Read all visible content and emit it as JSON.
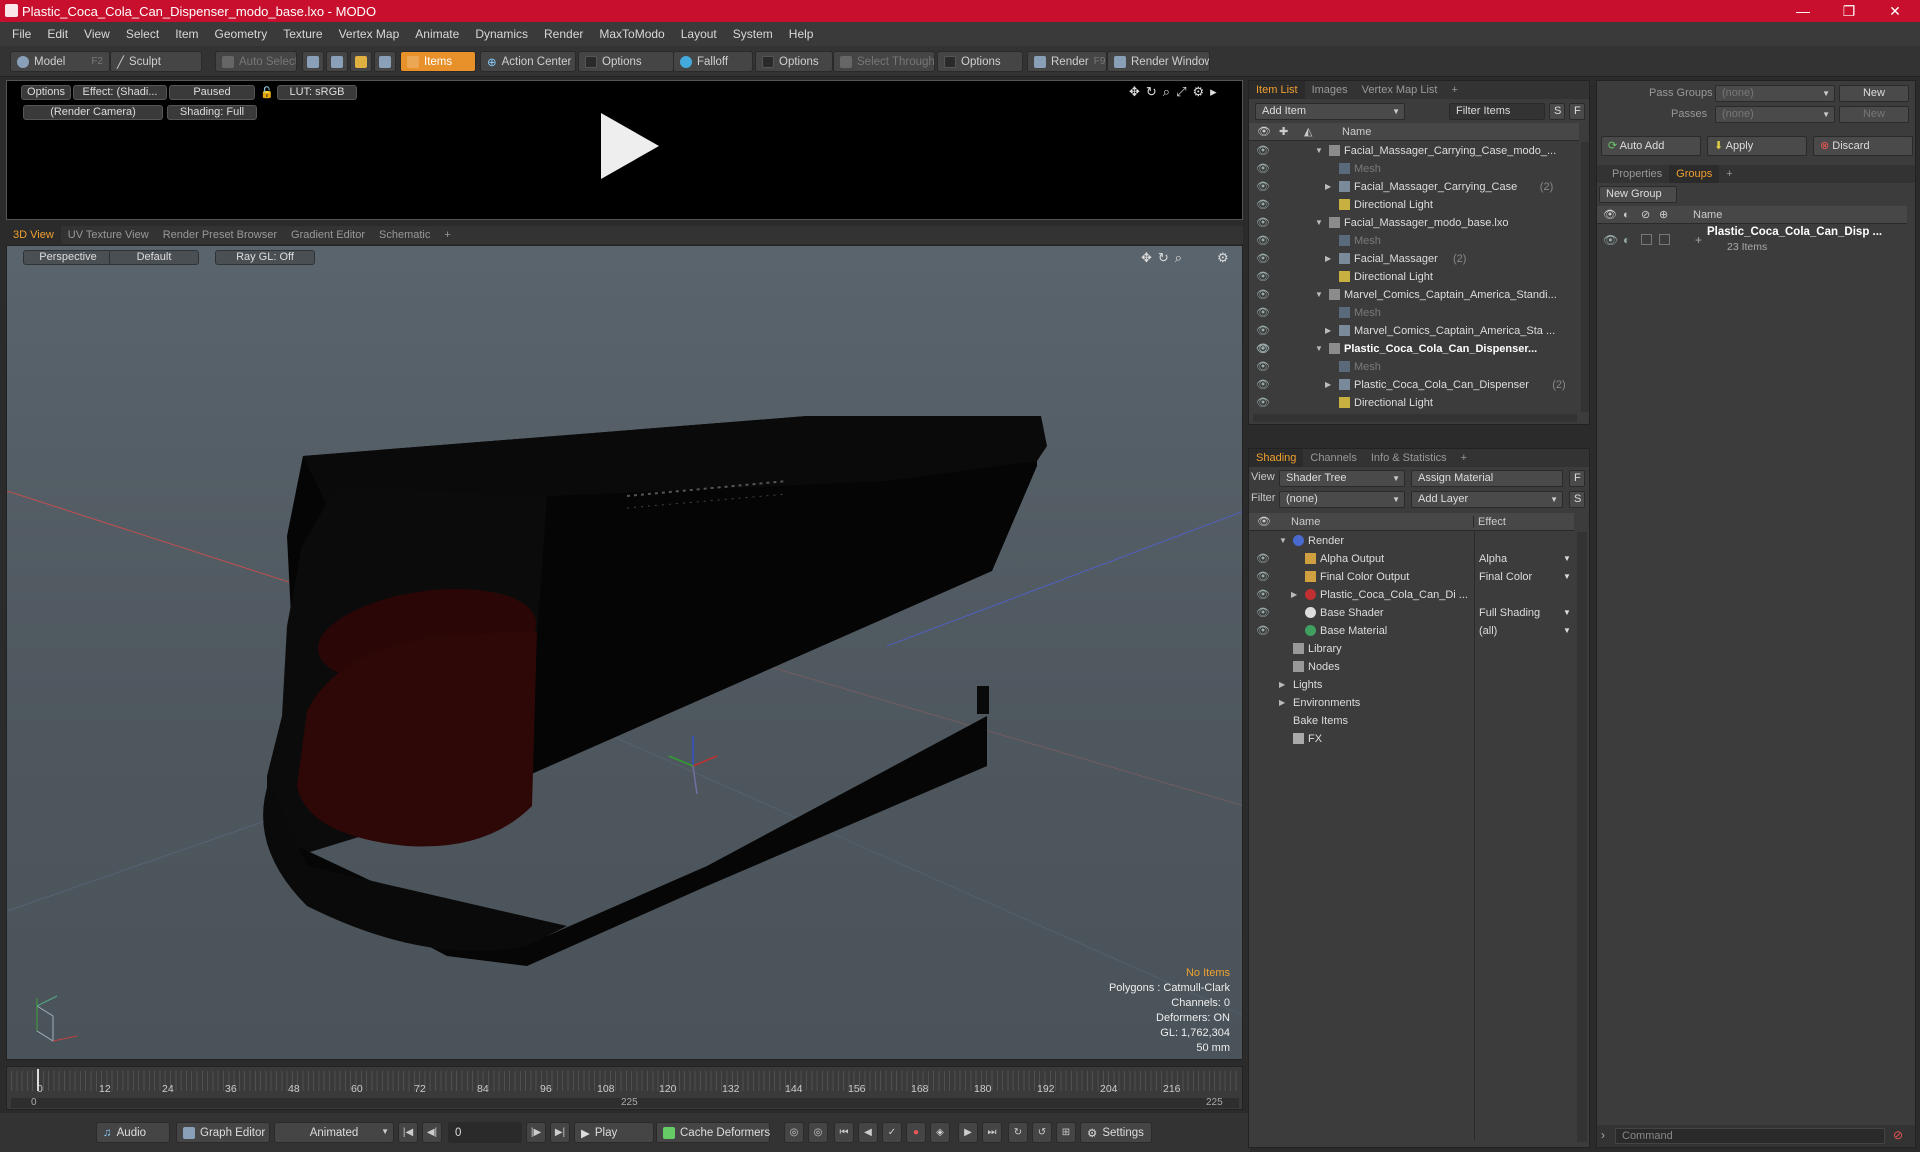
{
  "window": {
    "title": "Plastic_Coca_Cola_Can_Dispenser_modo_base.lxo - MODO",
    "minimize": "—",
    "maximize": "❐",
    "close": "✕"
  },
  "menu": [
    "File",
    "Edit",
    "View",
    "Select",
    "Item",
    "Geometry",
    "Texture",
    "Vertex Map",
    "Animate",
    "Dynamics",
    "Render",
    "MaxToModo",
    "Layout",
    "System",
    "Help"
  ],
  "toolbar": {
    "model": "Model",
    "model_key": "F2",
    "sculpt": "Sculpt",
    "auto_select": "Auto Select",
    "items": "Items",
    "action_center": "Action Center",
    "options1": "Options",
    "falloff": "Falloff",
    "options2": "Options",
    "select_through": "Select Through",
    "options3": "Options",
    "render": "Render",
    "render_key": "F9",
    "render_window": "Render Window"
  },
  "render_view": {
    "options": "Options",
    "effect": "Effect: (Shadi...",
    "paused": "Paused",
    "lut": "LUT: sRGB",
    "camera": "(Render Camera)",
    "shading": "Shading: Full"
  },
  "viewport_tabs": [
    "3D View",
    "UV Texture View",
    "Render Preset Browser",
    "Gradient Editor",
    "Schematic",
    "+"
  ],
  "viewport": {
    "perspective": "Perspective",
    "default": "Default",
    "raygl": "Ray GL: Off",
    "info": {
      "no_items": "No Items",
      "polygons": "Polygons : Catmull-Clark",
      "channels": "Channels: 0",
      "deformers": "Deformers: ON",
      "gl": "GL: 1,762,304",
      "focal": "50 mm"
    }
  },
  "timeline": {
    "ticks": [
      "0",
      "12",
      "24",
      "36",
      "48",
      "60",
      "72",
      "84",
      "96",
      "108",
      "120",
      "132",
      "144",
      "156",
      "168",
      "180",
      "192",
      "204",
      "216"
    ],
    "start": "0",
    "mid": "225",
    "end": "225"
  },
  "bottombar": {
    "audio": "Audio",
    "graph_editor": "Graph Editor",
    "animated": "Animated",
    "frame": "0",
    "play": "Play",
    "cache_deformers": "Cache Deformers",
    "settings": "Settings"
  },
  "itemlist": {
    "tabs": [
      "Item List",
      "Images",
      "Vertex Map List",
      "+"
    ],
    "add_item": "Add Item",
    "filter_items": "Filter Items",
    "s": "S",
    "f": "F",
    "name_header": "Name",
    "rows": [
      {
        "label": "Facial_Massager_Carrying_Case_modo_...",
        "indent": 0,
        "style": "normal",
        "tri": "▼"
      },
      {
        "label": "Mesh",
        "indent": 1,
        "style": "dim",
        "tri": ""
      },
      {
        "label": "Facial_Massager_Carrying_Case",
        "suffix": "(2)",
        "indent": 1,
        "style": "normal",
        "tri": "▶"
      },
      {
        "label": "Directional Light",
        "indent": 1,
        "style": "normal",
        "tri": ""
      },
      {
        "label": "Facial_Massager_modo_base.lxo",
        "indent": 0,
        "style": "normal",
        "tri": "▼"
      },
      {
        "label": "Mesh",
        "indent": 1,
        "style": "dim",
        "tri": ""
      },
      {
        "label": "Facial_Massager",
        "suffix": "(2)",
        "indent": 1,
        "style": "normal",
        "tri": "▶"
      },
      {
        "label": "Directional Light",
        "indent": 1,
        "style": "normal",
        "tri": ""
      },
      {
        "label": "Marvel_Comics_Captain_America_Standi...",
        "indent": 0,
        "style": "normal",
        "tri": "▼"
      },
      {
        "label": "Mesh",
        "indent": 1,
        "style": "dim",
        "tri": ""
      },
      {
        "label": "Marvel_Comics_Captain_America_Sta ...",
        "indent": 1,
        "style": "normal",
        "tri": "▶"
      },
      {
        "label": "Plastic_Coca_Cola_Can_Dispenser...",
        "indent": 0,
        "style": "bold",
        "tri": "▼"
      },
      {
        "label": "Mesh",
        "indent": 1,
        "style": "dim",
        "tri": ""
      },
      {
        "label": "Plastic_Coca_Cola_Can_Dispenser",
        "suffix": "(2)",
        "indent": 1,
        "style": "normal",
        "tri": "▶"
      },
      {
        "label": "Directional Light",
        "indent": 1,
        "style": "normal",
        "tri": ""
      }
    ]
  },
  "shading": {
    "tabs": [
      "Shading",
      "Channels",
      "Info & Statistics",
      "+"
    ],
    "view_label": "View",
    "view_value": "Shader Tree",
    "assign_material": "Assign Material",
    "f": "F",
    "filter_label": "Filter",
    "filter_value": "(none)",
    "add_layer": "Add Layer",
    "s": "S",
    "name_header": "Name",
    "effect_header": "Effect",
    "rows": [
      {
        "label": "Render",
        "effect": "",
        "indent": 0,
        "tri": "▼",
        "icon": "render",
        "eye": false
      },
      {
        "label": "Alpha Output",
        "effect": "Alpha",
        "indent": 1,
        "tri": "",
        "icon": "output",
        "eye": true
      },
      {
        "label": "Final Color Output",
        "effect": "Final Color",
        "indent": 1,
        "tri": "",
        "icon": "output",
        "eye": true
      },
      {
        "label": "Plastic_Coca_Cola_Can_Di ...",
        "effect": "",
        "indent": 1,
        "tri": "▶",
        "icon": "material",
        "eye": true
      },
      {
        "label": "Base Shader",
        "effect": "Full Shading",
        "indent": 1,
        "tri": "",
        "icon": "shader",
        "eye": true
      },
      {
        "label": "Base Material",
        "effect": "(all)",
        "indent": 1,
        "tri": "",
        "icon": "basemat",
        "eye": true
      },
      {
        "label": "Library",
        "effect": "",
        "indent": 0,
        "tri": "",
        "icon": "folder",
        "eye": false
      },
      {
        "label": "Nodes",
        "effect": "",
        "indent": 0,
        "tri": "",
        "icon": "folder",
        "eye": false
      },
      {
        "label": "Lights",
        "effect": "",
        "indent": 0,
        "tri": "▶",
        "icon": "",
        "eye": false
      },
      {
        "label": "Environments",
        "effect": "",
        "indent": 0,
        "tri": "▶",
        "icon": "",
        "eye": false
      },
      {
        "label": "Bake Items",
        "effect": "",
        "indent": 0,
        "tri": "",
        "icon": "",
        "eye": false
      },
      {
        "label": "FX",
        "effect": "",
        "indent": 0,
        "tri": "",
        "icon": "fx",
        "eye": false
      }
    ]
  },
  "groups": {
    "pass_groups_label": "Pass Groups",
    "pass_groups_value": "(none)",
    "new": "New",
    "passes_label": "Passes",
    "passes_value": "(none)",
    "new2": "New",
    "auto_add": "Auto Add",
    "apply": "Apply",
    "discard": "Discard",
    "tabs": [
      "Properties",
      "Groups",
      "+"
    ],
    "new_group": "New Group",
    "name_header": "Name",
    "group_name": "Plastic_Coca_Cola_Can_Disp ...",
    "group_count": "23 Items",
    "command_placeholder": "Command"
  },
  "colors": {
    "titlebar": "#c8102e",
    "accent": "#e8912a",
    "active_tab": "#f0a030"
  }
}
